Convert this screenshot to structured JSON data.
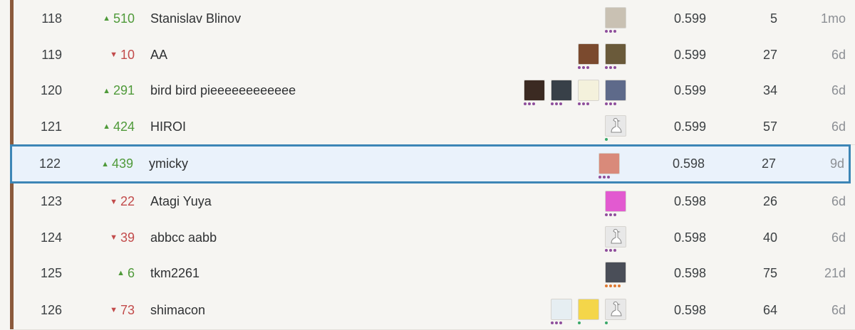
{
  "rows": [
    {
      "rank": "118",
      "change_dir": "up",
      "change": "510",
      "team": "Stanislav Blinov",
      "score": "0.599",
      "entries": "5",
      "last": "1mo",
      "members": [
        {
          "icon": "portrait-man-suit",
          "color": "#c9c1b3",
          "dots": [
            "purple",
            "purple",
            "purple"
          ]
        }
      ]
    },
    {
      "rank": "119",
      "change_dir": "down",
      "change": "10",
      "team": "AA",
      "score": "0.599",
      "entries": "27",
      "last": "6d",
      "members": [
        {
          "icon": "portrait-man-glasses",
          "color": "#7b4a2e",
          "dots": [
            "purple",
            "purple",
            "purple"
          ]
        },
        {
          "icon": "horses-photo",
          "color": "#6a5a3a",
          "dots": [
            "purple",
            "purple",
            "purple"
          ]
        }
      ]
    },
    {
      "rank": "120",
      "change_dir": "up",
      "change": "291",
      "team": "bird bird pieeeeeeeeeeee",
      "score": "0.599",
      "entries": "34",
      "last": "6d",
      "members": [
        {
          "icon": "anime-character-dark",
          "color": "#3b2a22",
          "dots": [
            "purple",
            "purple",
            "purple"
          ]
        },
        {
          "icon": "anime-character-sunglasses",
          "color": "#384048",
          "dots": [
            "purple",
            "purple",
            "purple"
          ]
        },
        {
          "icon": "sketch-doodle",
          "color": "#f4f1dc",
          "dots": [
            "purple",
            "purple",
            "purple"
          ]
        },
        {
          "icon": "anime-character-blue",
          "color": "#5e6a8a",
          "dots": [
            "purple",
            "purple",
            "purple"
          ]
        }
      ]
    },
    {
      "rank": "121",
      "change_dir": "up",
      "change": "424",
      "team": "HIROI",
      "score": "0.599",
      "entries": "57",
      "last": "6d",
      "members": [
        {
          "icon": "goose-default",
          "color": "#e8e8e8",
          "dots": [
            "green"
          ]
        }
      ]
    },
    {
      "rank": "122",
      "change_dir": "up",
      "change": "439",
      "team": "ymicky",
      "score": "0.598",
      "entries": "27",
      "last": "9d",
      "selected": true,
      "members": [
        {
          "icon": "anime-girl-red-hair",
          "color": "#d98a7a",
          "dots": [
            "purple",
            "purple",
            "purple"
          ]
        }
      ]
    },
    {
      "rank": "123",
      "change_dir": "down",
      "change": "22",
      "team": "Atagi Yuya",
      "score": "0.598",
      "entries": "26",
      "last": "6d",
      "members": [
        {
          "icon": "pink-circle-logo",
          "color": "#e25ad0",
          "dots": [
            "purple",
            "purple",
            "purple"
          ]
        }
      ]
    },
    {
      "rank": "124",
      "change_dir": "down",
      "change": "39",
      "team": "abbcc aabb",
      "score": "0.598",
      "entries": "40",
      "last": "6d",
      "members": [
        {
          "icon": "goose-default",
          "color": "#e8e8e8",
          "dots": [
            "purple",
            "purple",
            "purple"
          ]
        }
      ]
    },
    {
      "rank": "125",
      "change_dir": "up",
      "change": "6",
      "team": "tkm2261",
      "score": "0.598",
      "entries": "75",
      "last": "21d",
      "members": [
        {
          "icon": "landscape-photo",
          "color": "#4a4e58",
          "dots": [
            "orange",
            "orange",
            "orange",
            "orange"
          ]
        }
      ]
    },
    {
      "rank": "126",
      "change_dir": "down",
      "change": "73",
      "team": "shimacon",
      "score": "0.598",
      "entries": "64",
      "last": "6d",
      "members": [
        {
          "icon": "witch-character",
          "color": "#e6eef2",
          "dots": [
            "purple",
            "purple",
            "purple"
          ]
        },
        {
          "icon": "yellow-face-flower",
          "color": "#f4d64a",
          "dots": [
            "green"
          ]
        },
        {
          "icon": "goose-default",
          "color": "#e8e8e8",
          "dots": [
            "green"
          ]
        }
      ]
    }
  ]
}
